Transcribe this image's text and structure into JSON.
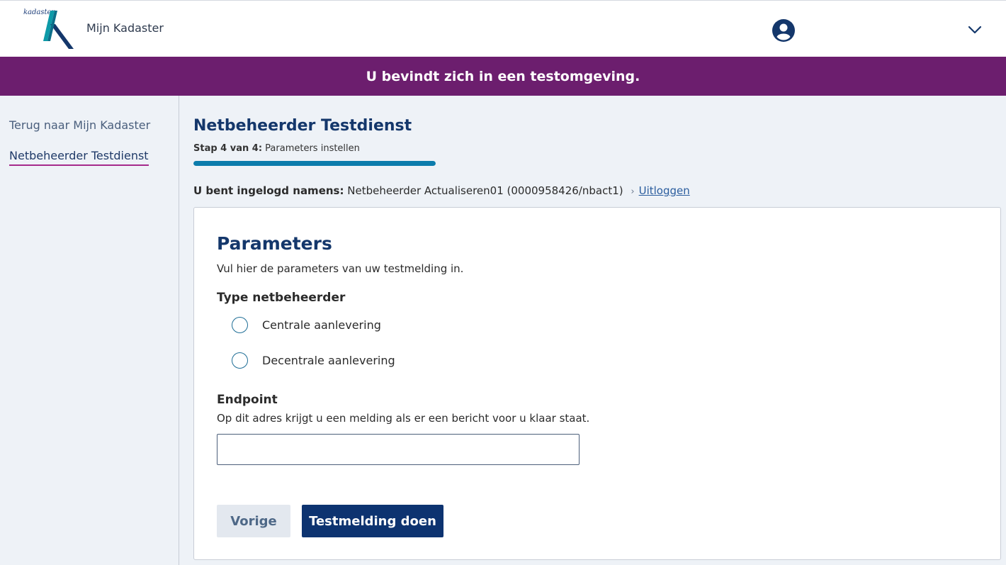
{
  "header": {
    "logo_text": "kadaster",
    "app_name": "Mijn Kadaster",
    "user_icon": "user-circle-icon",
    "menu_icon": "chevron-down-icon"
  },
  "banner": {
    "text": "U bevindt zich in een testomgeving."
  },
  "sidebar": {
    "items": [
      {
        "label": "Terug naar Mijn Kadaster"
      },
      {
        "label": "Netbeheerder Testdienst"
      }
    ]
  },
  "main": {
    "title": "Netbeheerder Testdienst",
    "step_prefix": "Stap 4 van 4:",
    "step_text": "Parameters instellen",
    "progress_fraction": 1.0,
    "login_prefix": "U bent ingelogd namens:",
    "login_value": "Netbeheerder Actualiseren01 (0000958426/nbact1)",
    "separator": "›",
    "logout_label": "Uitloggen"
  },
  "form": {
    "title": "Parameters",
    "intro": "Vul hier de parameters van uw testmelding in.",
    "type_label": "Type netbeheerder",
    "options": [
      {
        "label": "Centrale aanlevering"
      },
      {
        "label": "Decentrale aanlevering"
      }
    ],
    "endpoint_label": "Endpoint",
    "endpoint_help": "Op dit adres krijgt u een melding als er een bericht voor u klaar staat.",
    "endpoint_value": "",
    "endpoint_placeholder": ""
  },
  "actions": {
    "prev_label": "Vorige",
    "submit_label": "Testmelding doen"
  },
  "colors": {
    "banner": "#6c1e6e",
    "primary": "#0d3370",
    "progress": "#0b7cac",
    "active_underline": "#a62a8c"
  }
}
